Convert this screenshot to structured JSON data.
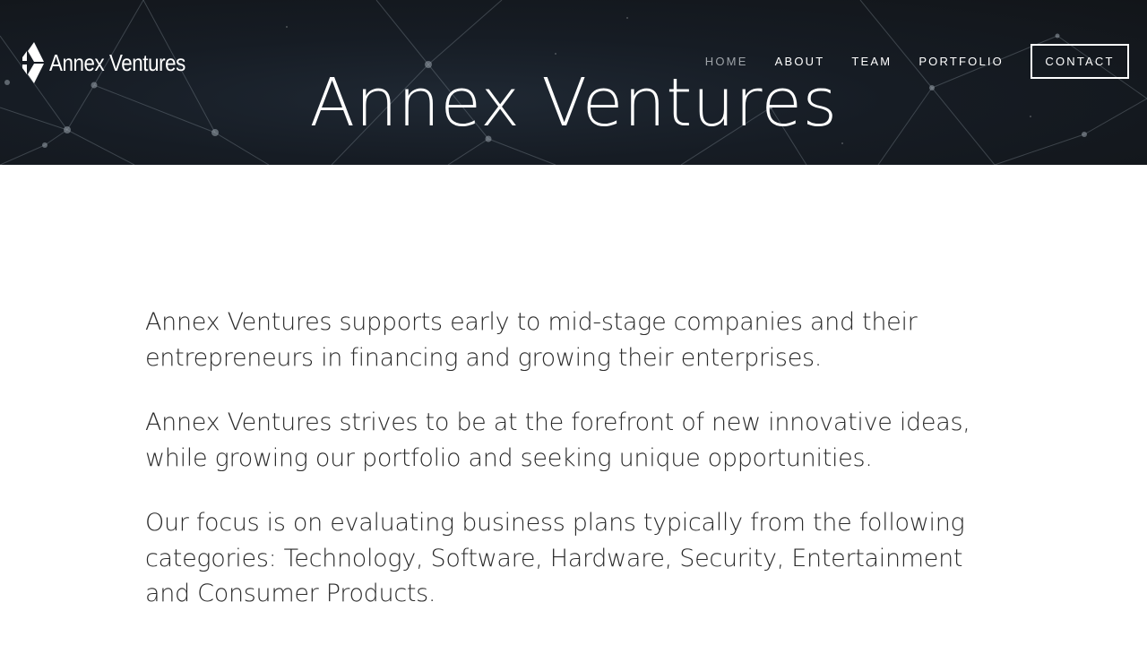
{
  "header": {
    "logo_text": "Annex Ventures",
    "hero_title": "Annex Ventures"
  },
  "nav": {
    "items": [
      {
        "label": "HOME",
        "active": true
      },
      {
        "label": "ABOUT",
        "active": false
      },
      {
        "label": "TEAM",
        "active": false
      },
      {
        "label": "PORTFOLIO",
        "active": false
      }
    ],
    "contact_label": "CONTACT"
  },
  "main": {
    "paragraphs": [
      "Annex Ventures supports early to mid-stage companies and their entrepreneurs in financing and growing their enterprises.",
      "Annex Ventures strives to be at the forefront of new innovative ideas, while growing our portfolio and seeking unique opportunities.",
      "Our focus is on evaluating business plans typically from the following categories: Technology, Software, Hardware, Security, Entertainment and Consumer Products."
    ]
  },
  "colors": {
    "hero_background": "#161c24",
    "nav_active": "#9ea3a8",
    "nav_text": "#ffffff",
    "body_text": "#2a2a2a"
  },
  "icons": {
    "logo_mark": "annex-logo-icon"
  }
}
